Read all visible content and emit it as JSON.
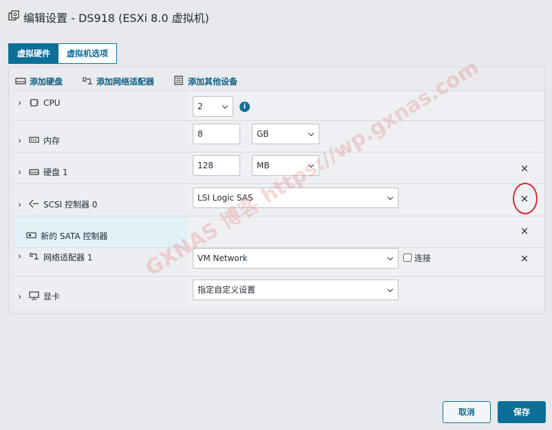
{
  "window": {
    "title": "编辑设置 - DS918 (ESXi 8.0 虚拟机)"
  },
  "tabs": [
    {
      "label": "虚拟硬件",
      "active": true
    },
    {
      "label": "虚拟机选项",
      "active": false
    }
  ],
  "toolbar": {
    "add_disk": "添加硬盘",
    "add_nic": "添加网络适配器",
    "add_other": "添加其他设备"
  },
  "rows": {
    "cpu": {
      "label": "CPU",
      "value": "2",
      "info_icon": "i"
    },
    "memory": {
      "label": "内存",
      "value": "8",
      "unit": "GB"
    },
    "disk": {
      "label": "硬盘 1",
      "value": "128",
      "unit": "MB",
      "close": "×"
    },
    "scsi": {
      "label": "SCSI 控制器 0",
      "value": "LSI Logic SAS",
      "close": "×"
    },
    "sata": {
      "label": "新的 SATA 控制器",
      "close": "×"
    },
    "nic": {
      "label": "网络适配器 1",
      "value": "VM Network",
      "connect_label": "连接",
      "connected": false,
      "close": "×"
    },
    "video": {
      "label": "显卡",
      "value": "指定自定义设置"
    }
  },
  "watermark": "GXNAS 博客 https://wp.gxnas.com",
  "footer": {
    "cancel": "取消",
    "save": "保存"
  },
  "colors": {
    "accent": "#0d6e98",
    "highlight_circle": "#d9242a"
  }
}
